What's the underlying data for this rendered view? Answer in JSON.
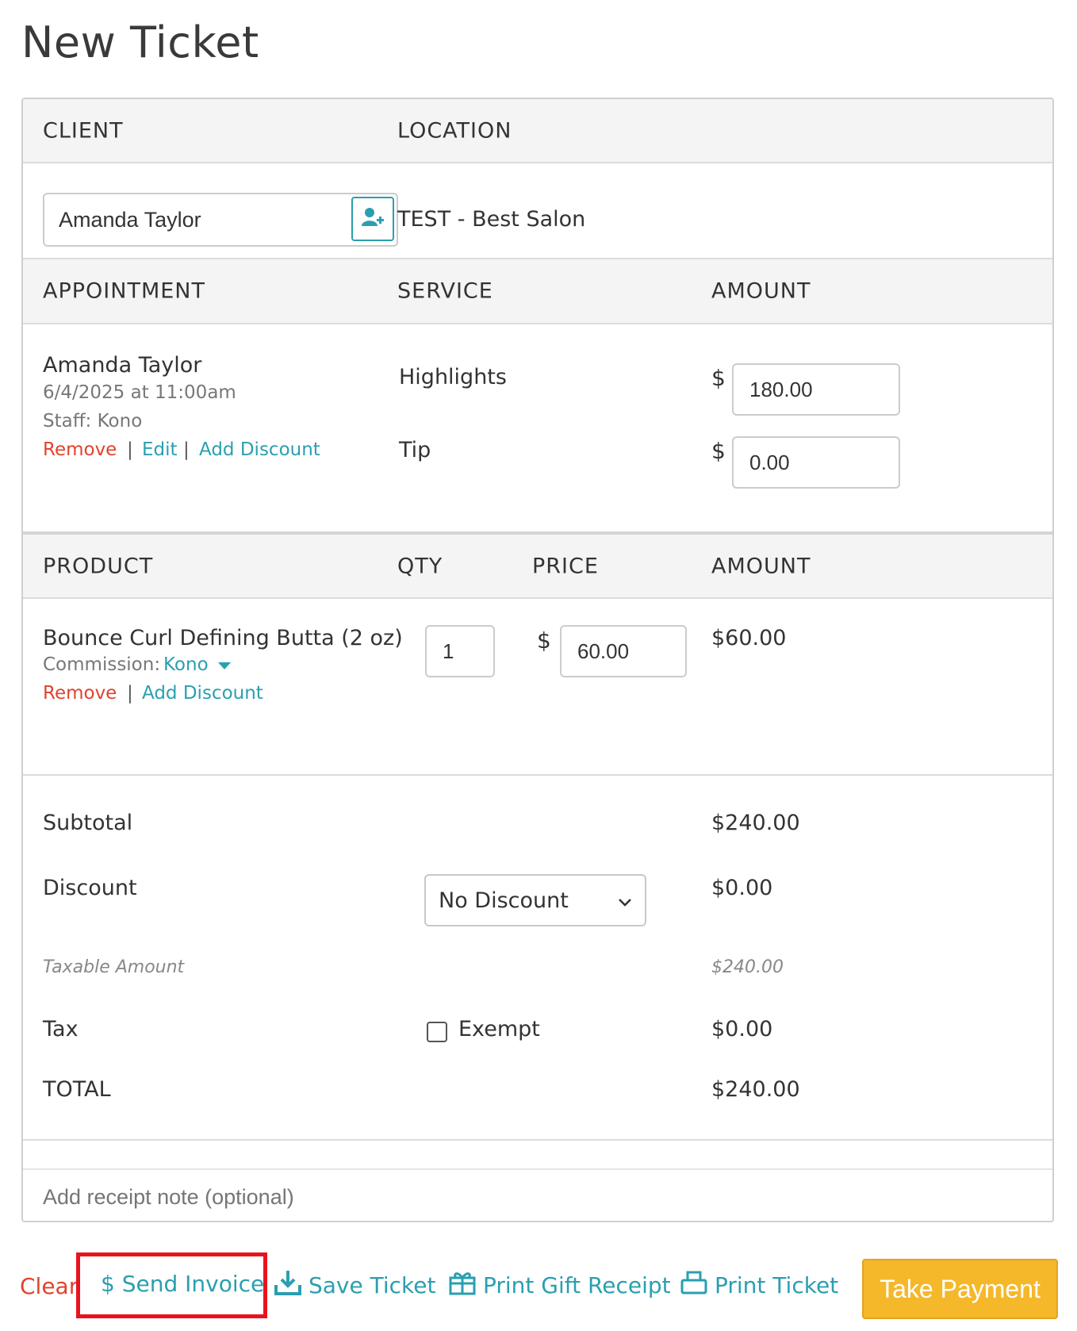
{
  "page": {
    "title": "New Ticket"
  },
  "client_section": {
    "client_header": "CLIENT",
    "location_header": "LOCATION",
    "client_value": "Amanda Taylor",
    "add_client_icon": "add-person-icon",
    "location_value": "TEST - Best Salon"
  },
  "appointment_section": {
    "headers": {
      "appointment": "APPOINTMENT",
      "service": "SERVICE",
      "amount": "AMOUNT"
    },
    "client_name": "Amanda Taylor",
    "datetime": "6/4/2025 at 11:00am",
    "staff": "Staff: Kono",
    "actions": {
      "remove": "Remove",
      "edit": "Edit",
      "add_discount": "Add Discount",
      "separator": "|"
    },
    "service_name": "Highlights",
    "tip_label": "Tip",
    "currency": "$",
    "service_amount": "180.00",
    "tip_amount": "0.00"
  },
  "product_section": {
    "headers": {
      "product": "PRODUCT",
      "qty": "QTY",
      "price": "PRICE",
      "amount": "AMOUNT"
    },
    "product_name": "Bounce Curl Defining Butta (2 oz)",
    "commission_label": "Commission:",
    "commission_value": "Kono",
    "actions": {
      "remove": "Remove",
      "add_discount": "Add Discount",
      "separator": "|"
    },
    "qty": "1",
    "currency": "$",
    "price": "60.00",
    "amount": "$60.00"
  },
  "totals": {
    "subtotal_label": "Subtotal",
    "subtotal_value": "$240.00",
    "discount_label": "Discount",
    "discount_select": "No Discount",
    "discount_value": "$0.00",
    "taxable_label": "Taxable Amount",
    "taxable_value": "$240.00",
    "tax_label": "Tax",
    "exempt_label": "Exempt",
    "exempt_checked": false,
    "tax_value": "$0.00",
    "total_label": "TOTAL",
    "total_value": "$240.00"
  },
  "receipt_note": {
    "placeholder": "Add receipt note (optional)"
  },
  "footer": {
    "clear": "Clear",
    "send_invoice": "$ Send Invoice",
    "save_ticket": "Save Ticket",
    "print_gift_receipt": "Print Gift Receipt",
    "print_ticket": "Print Ticket",
    "take_payment": "Take Payment"
  },
  "colors": {
    "accent": "#2a9fb0",
    "danger": "#e0432d",
    "primary_button": "#f5b82a",
    "highlight": "#e8131c"
  }
}
